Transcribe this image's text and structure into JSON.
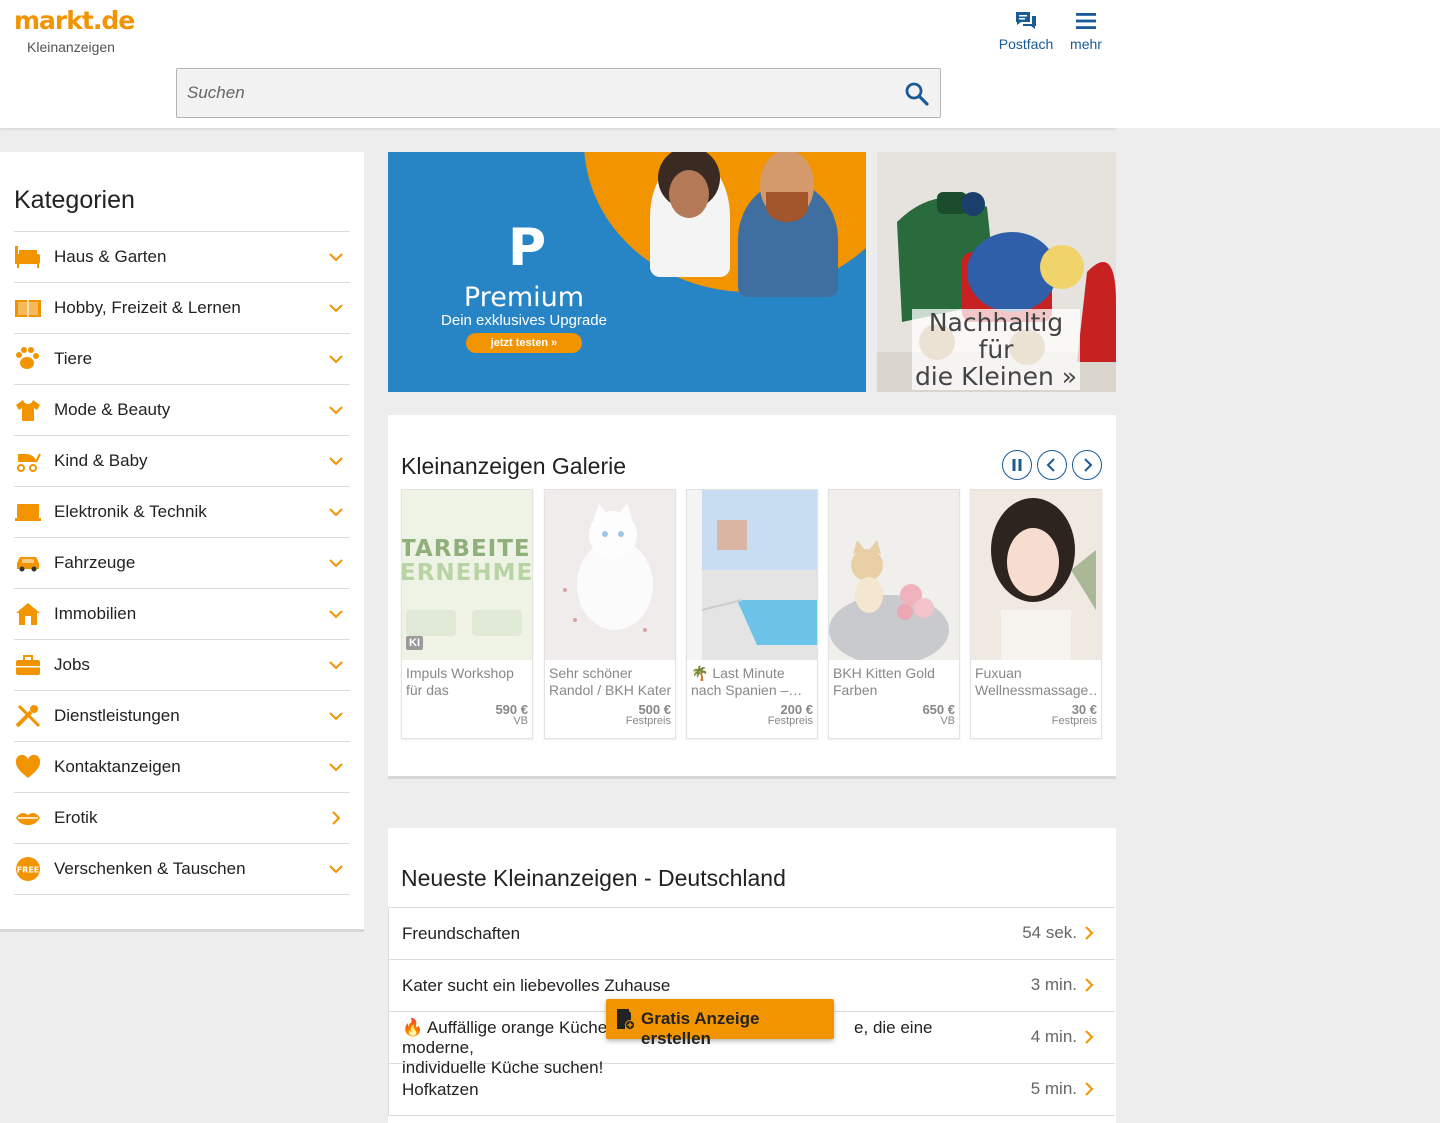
{
  "header": {
    "logo": "markt.de",
    "logo_sub": "Kleinanzeigen",
    "postfach_label": "Postfach",
    "mehr_label": "mehr",
    "search_placeholder": "Suchen"
  },
  "colors": {
    "accent": "#f29400",
    "link": "#1a5a96",
    "banner_blue": "#2785c5"
  },
  "sidebar": {
    "title": "Kategorien",
    "items": [
      {
        "label": "Haus & Garten",
        "icon": "sofa-icon",
        "chevron": "down"
      },
      {
        "label": "Hobby, Freizeit & Lernen",
        "icon": "book-icon",
        "chevron": "down"
      },
      {
        "label": "Tiere",
        "icon": "paw-icon",
        "chevron": "down"
      },
      {
        "label": "Mode & Beauty",
        "icon": "tshirt-icon",
        "chevron": "down"
      },
      {
        "label": "Kind & Baby",
        "icon": "stroller-icon",
        "chevron": "down"
      },
      {
        "label": "Elektronik & Technik",
        "icon": "laptop-icon",
        "chevron": "down"
      },
      {
        "label": "Fahrzeuge",
        "icon": "car-icon",
        "chevron": "down"
      },
      {
        "label": "Immobilien",
        "icon": "house-icon",
        "chevron": "down"
      },
      {
        "label": "Jobs",
        "icon": "briefcase-icon",
        "chevron": "down"
      },
      {
        "label": "Dienstleistungen",
        "icon": "tools-icon",
        "chevron": "down"
      },
      {
        "label": "Kontaktanzeigen",
        "icon": "heart-icon",
        "chevron": "down"
      },
      {
        "label": "Erotik",
        "icon": "lips-icon",
        "chevron": "right"
      },
      {
        "label": "Verschenken & Tauschen",
        "icon": "free-badge-icon",
        "chevron": "down"
      }
    ]
  },
  "banners": {
    "premium": {
      "logo": "P",
      "title": "Premium",
      "subtitle": "Dein exklusives Upgrade",
      "button": "jetzt testen »"
    },
    "kids": {
      "line1": "Nachhaltig für",
      "line2": "die Kleinen »"
    }
  },
  "gallery": {
    "title": "Kleinanzeigen Galerie",
    "items": [
      {
        "title": "Impuls Workshop für das Betriebliche…",
        "price": "590 €",
        "type": "VB",
        "badge": "KI"
      },
      {
        "title": "Sehr schöner Randol / BKH Kater",
        "price": "500 €",
        "type": "Festpreis"
      },
      {
        "title": "🌴 Last Minute nach Spanien –…",
        "price": "200 €",
        "type": "Festpreis"
      },
      {
        "title": "BKH Kitten Gold Farben",
        "price": "650 €",
        "type": "VB"
      },
      {
        "title": "Fuxuan Wellnessmassage…",
        "price": "30 €",
        "type": "Festpreis"
      }
    ],
    "workshop_text1": "TARBEITER.",
    "workshop_text2": "ERNEHMEN."
  },
  "newest": {
    "title": "Neueste Kleinanzeigen - Deutschland",
    "items": [
      {
        "title": "Freundschaften",
        "time": "54 sek."
      },
      {
        "title": "Kater sucht ein liebevolles Zuhause",
        "time": "3 min."
      },
      {
        "title": "🔥 Auffällige orange Küche mit … für alle, die eine moderne, individuelle Küche suchen!",
        "time": "4 min.",
        "title_a": "🔥 Auffällige orange Küche m",
        "title_b": "e, die eine moderne,",
        "title_c": "individuelle Küche suchen!"
      },
      {
        "title": "Hofkatzen",
        "time": "5 min."
      }
    ]
  },
  "cta": {
    "label": "Gratis Anzeige erstellen"
  }
}
